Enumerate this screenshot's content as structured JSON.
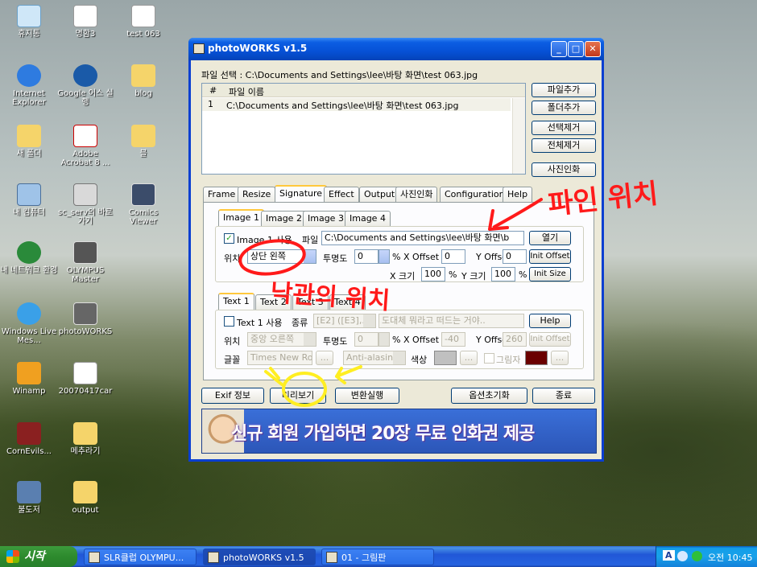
{
  "desktop": {
    "icons": [
      {
        "label": "휴지통"
      },
      {
        "label": "명함3"
      },
      {
        "label": "test 063"
      },
      {
        "label": "Internet Explorer"
      },
      {
        "label": "Google 어스 실행"
      },
      {
        "label": "blog"
      },
      {
        "label": "새 폴더"
      },
      {
        "label": "Adobe Acrobat 8 ..."
      },
      {
        "label": "블"
      },
      {
        "label": "내 컴퓨터"
      },
      {
        "label": "sc_serv의 바로 가기"
      },
      {
        "label": "Comics Viewer"
      },
      {
        "label": "내 네트워크 환경"
      },
      {
        "label": "OLYMPUS Master"
      },
      {
        "label": "Windows Live Mes..."
      },
      {
        "label": "photoWORKS"
      },
      {
        "label": "Winamp"
      },
      {
        "label": "20070417car"
      },
      {
        "label": "CornEvils..."
      },
      {
        "label": "메추라기"
      },
      {
        "label": "불도저"
      },
      {
        "label": "output"
      }
    ]
  },
  "window": {
    "title": "photoWORKS v1.5",
    "file_select": "파일 선택 : C:\\Documents and Settings\\lee\\바탕 화면\\test 063.jpg",
    "list": {
      "col_num": "#",
      "col_name": "파일 이름",
      "rows": [
        {
          "num": "1",
          "name": "C:\\Documents and Settings\\lee\\바탕 화면\\test 063.jpg"
        }
      ]
    },
    "side_buttons": [
      "파일추가",
      "폴더추가",
      "선택제거",
      "전체제거",
      "사진인화"
    ],
    "tabs": [
      "Frame",
      "Resize",
      "Signature",
      "Effect",
      "Output",
      "사진인화",
      "Configuration",
      "Help"
    ],
    "image_tabs": [
      "Image 1",
      "Image 2",
      "Image 3",
      "Image 4"
    ],
    "image": {
      "use_label": "Image 1 사용",
      "file_label": "파일",
      "file_value": "C:\\Documents and Settings\\lee\\바탕 화면\\b",
      "open": "열기",
      "pos_label": "위치",
      "pos_value": "상단 왼쪽",
      "opacity_label": "투명도",
      "opacity_value": "0",
      "pct": "%",
      "xoff_label": "X Offset",
      "xoff_value": "0",
      "yoff_label": "Y Offset",
      "yoff_value": "0",
      "init_offset": "Init Offset",
      "xsize_label": "X 크기",
      "xsize_value": "100",
      "ysize_label": "Y 크기",
      "ysize_value": "100",
      "init_size": "Init Size"
    },
    "text_tabs": [
      "Text 1",
      "Text 2",
      "Text 3",
      "Text 4"
    ],
    "text": {
      "use_label": "Text 1 사용",
      "kind_label": "종류",
      "kind_value": "[E2] ([E3],...",
      "content_value": "도대체 뭐라고 떠드는 거야..",
      "help": "Help",
      "pos_label": "위치",
      "pos_value": "중앙 오른쪽",
      "opacity_label": "투명도",
      "opacity_value": "0",
      "pct": "%",
      "xoff_label": "X Offset",
      "xoff_value": "-40",
      "yoff_label": "Y Offset",
      "yoff_value": "260",
      "init_offset": "Init Offset",
      "font_label": "글꼴",
      "font_value": "Times New Ro",
      "dots": "...",
      "aa_value": "Anti-alasin",
      "color_label": "색상",
      "shadow_label": "그림자"
    },
    "bottom_buttons": {
      "exif": "Exif 정보",
      "preview": "미리보기",
      "convert": "변환실행",
      "reset": "옵션초기화",
      "exit": "종료"
    },
    "banner": "신규 회원 가입하면 20장 무료 인화권 제공"
  },
  "annotations": {
    "file_pos": "파인 위치",
    "stamp_pos": "낙관의 위치"
  },
  "taskbar": {
    "start": "시작",
    "items": [
      "SLR클럽 OLYMPU...",
      "photoWORKS v1.5",
      "01 - 그림판"
    ],
    "clock": "오전 10:45",
    "lang": "A"
  },
  "colors": {
    "title_blue": "#0651d6",
    "start_green": "#2d8a2d",
    "annotation_red": "#ff1a1a",
    "annotation_yellow": "#ffee22",
    "text_color_swatch": "#c0c0c0",
    "shadow_swatch": "#6a0000"
  }
}
